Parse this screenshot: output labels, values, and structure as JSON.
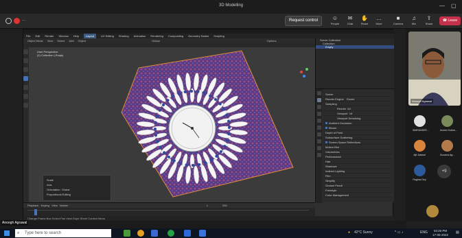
{
  "window": {
    "title": "3D Modelling"
  },
  "meeting": {
    "dots": "...",
    "request_control": "Request control",
    "toolbar": [
      {
        "icon": "people-icon",
        "label": "People"
      },
      {
        "icon": "chat-icon",
        "label": "Chat"
      },
      {
        "icon": "react-icon",
        "label": "React"
      },
      {
        "icon": "more-icon",
        "label": "More"
      },
      {
        "icon": "camera-icon",
        "label": "Camera"
      },
      {
        "icon": "mic-icon",
        "label": "Mic"
      },
      {
        "icon": "share-icon",
        "label": "Share"
      }
    ],
    "leave": "Leave"
  },
  "blender": {
    "menu": [
      "File",
      "Edit",
      "Render",
      "Window",
      "Help",
      "Layout",
      "UV Editing",
      "Shading",
      "Animation",
      "Rendering",
      "Compositing",
      "Geometry Nodes",
      "Scripting"
    ],
    "active_workspace": "Layout",
    "toolbar": [
      "Object Mode",
      "View",
      "Select",
      "Add",
      "Object",
      "Global",
      "Options"
    ],
    "viewport": {
      "view_name": "User Perspective",
      "collection": "(1) Collection | Empty"
    },
    "redo_panel": {
      "rows": [
        "Scale",
        "Axis",
        "Orientation",
        "Proportional Editing"
      ],
      "orientation_value": "Global"
    },
    "timeline": {
      "items": [
        "Playback",
        "Keying",
        "View",
        "Marker"
      ],
      "start": "1",
      "end": "250",
      "status": "Change Frame   Box Select   Pan View   Dope Sheet Context Menu"
    },
    "outliner": {
      "rows": [
        "Scene Collection",
        "Collection",
        "Empty"
      ]
    },
    "properties": {
      "scene": "Scene",
      "render_engine": "Render Engine",
      "engine_value": "Eevee",
      "sections": [
        "Sampling",
        "Render",
        "Viewport",
        "Viewport Denoising",
        "Ambient Occlusion",
        "Bloom",
        "Depth of Field",
        "Subsurface Scattering",
        "Screen Space Reflections",
        "Motion Blur",
        "Volumetrics",
        "Performance",
        "Hair",
        "Shadows",
        "Indirect Lighting",
        "Film",
        "Simplify",
        "Grease Pencil",
        "Freestyle",
        "Color Management"
      ],
      "render_value": "64",
      "viewport_value": "16"
    }
  },
  "gallery": {
    "self": "Anoogh Agrawal",
    "participants": [
      {
        "name": "SIMRANDEE...",
        "color": "#e0e0e0"
      },
      {
        "name": "Avneer Kulkre...",
        "color": "#7a8a5a"
      },
      {
        "name": "Ajit Jaiswal",
        "color": "#d9843a"
      },
      {
        "name": "Suvarna Ag...",
        "color": "#b37a4a"
      },
      {
        "name": "Raghav Dey",
        "color": "#2d5a9a"
      }
    ],
    "more": "+9"
  },
  "presenter_label": "Anoogh Agrawal",
  "taskbar": {
    "search_placeholder": "Type here to search",
    "weather": "42°C Sunny",
    "lang": "ENG",
    "time": "03:26 PM",
    "date": "17-05-2022"
  }
}
